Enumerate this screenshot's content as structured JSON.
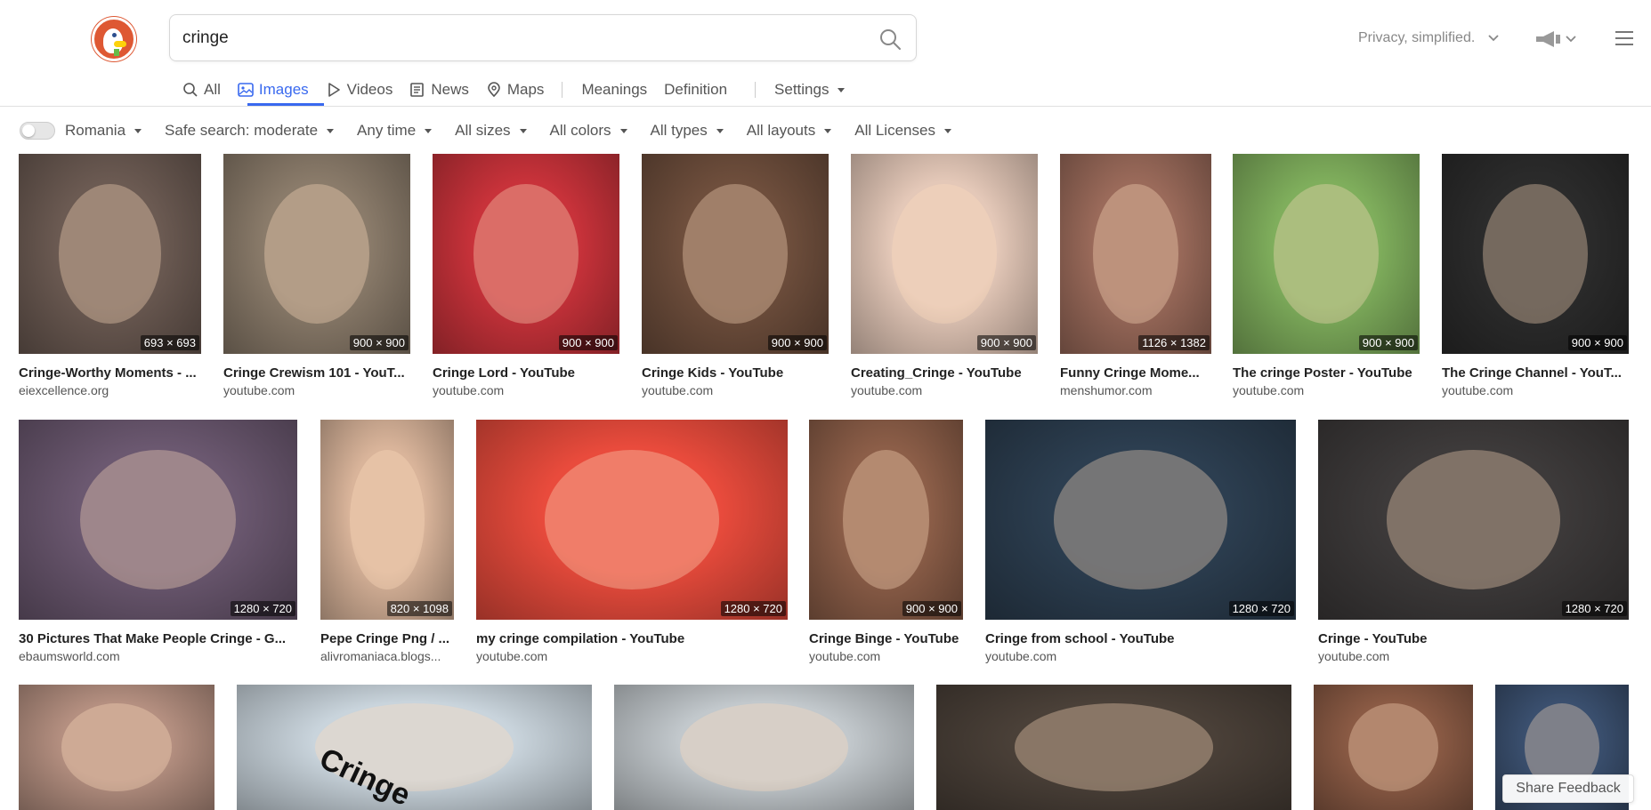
{
  "search": {
    "query": "cringe"
  },
  "header": {
    "privacy_label": "Privacy, simplified.",
    "chevron": "⌄"
  },
  "tabs": [
    {
      "label": "All",
      "icon": "search-icon"
    },
    {
      "label": "Images",
      "icon": "image-icon",
      "active": true
    },
    {
      "label": "Videos",
      "icon": "play-icon"
    },
    {
      "label": "News",
      "icon": "news-icon"
    },
    {
      "label": "Maps",
      "icon": "map-pin-icon"
    },
    {
      "label": "Meanings"
    },
    {
      "label": "Definition"
    },
    {
      "label": "Settings"
    }
  ],
  "filters": {
    "region": "Romania",
    "safe_search": "Safe search: moderate",
    "time": "Any time",
    "sizes": "All sizes",
    "colors": "All colors",
    "types": "All types",
    "layouts": "All layouts",
    "licenses": "All Licenses"
  },
  "results": [
    {
      "title": "Cringe-Worthy Moments - ...",
      "source": "eiexcellence.org",
      "dims": "693 × 693",
      "color": "#6b5a52"
    },
    {
      "title": "Cringe Crewism 101 - YouT...",
      "source": "youtube.com",
      "dims": "900 × 900",
      "color": "#8a7b6a"
    },
    {
      "title": "Cringe Lord - YouTube",
      "source": "youtube.com",
      "dims": "900 × 900",
      "color": "#c8323a"
    },
    {
      "title": "Cringe Kids - YouTube",
      "source": "youtube.com",
      "dims": "900 × 900",
      "color": "#6e4e3c"
    },
    {
      "title": "Creating_Cringe - YouTube",
      "source": "youtube.com",
      "dims": "900 × 900",
      "color": "#e4c8b8"
    },
    {
      "title": "Funny Cringe Mome...",
      "source": "menshumor.com",
      "dims": "1126 × 1382",
      "color": "#9a6a5a"
    },
    {
      "title": "The cringe Poster - YouTube",
      "source": "youtube.com",
      "dims": "900 × 900",
      "color": "#7fae5c"
    },
    {
      "title": "The Cringe Channel - YouT...",
      "source": "youtube.com",
      "dims": "900 × 900",
      "color": "#2b2b2b"
    },
    {
      "title": "30 Pictures That Make People Cringe - G...",
      "source": "ebaumsworld.com",
      "dims": "1280 × 720",
      "color": "#6b5870"
    },
    {
      "title": "Pepe Cringe Png / ...",
      "source": "alivromaniaca.blogs...",
      "dims": "820 × 1098",
      "color": "#d9b49a"
    },
    {
      "title": "my cringe compilation - YouTube",
      "source": "youtube.com",
      "dims": "1280 × 720",
      "color": "#e94b3c"
    },
    {
      "title": "Cringe Binge - YouTube",
      "source": "youtube.com",
      "dims": "900 × 900",
      "color": "#8c5e48"
    },
    {
      "title": "Cringe from school - YouTube",
      "source": "youtube.com",
      "dims": "1280 × 720",
      "color": "#2c3e50"
    },
    {
      "title": "Cringe - YouTube",
      "source": "youtube.com",
      "dims": "1280 × 720",
      "color": "#3d3a3a"
    },
    {
      "color": "#b48f80"
    },
    {
      "color": "#c9d4dc",
      "overlay": "Cringe"
    },
    {
      "color": "#c2c8cc"
    },
    {
      "color": "#4a4038"
    },
    {
      "color": "#8a5a44"
    },
    {
      "color": "#3a4f6e"
    }
  ],
  "feedback_label": "Share Feedback"
}
